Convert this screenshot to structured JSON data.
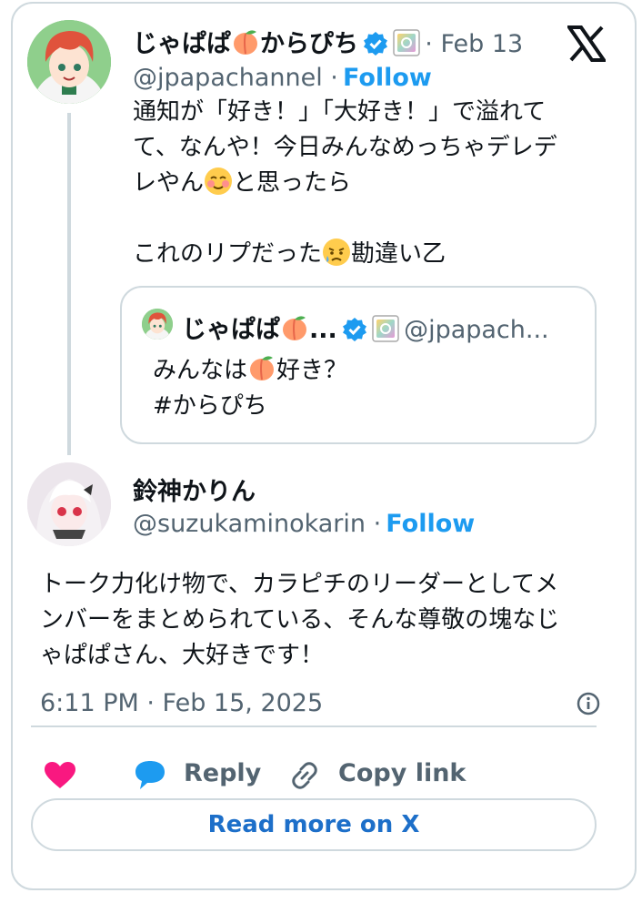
{
  "original_tweet": {
    "display_name": "じゃぱぱ🍑からぴち",
    "name_before_emoji": "じゃぱぱ",
    "name_after_emoji": "からぴち",
    "date": "· Feb 13",
    "handle": "@jpapachannel ·",
    "follow_label": "Follow",
    "text_line1": "通知が「好き！」「大好き！」で溢れて",
    "text_line2": "て、なんや！今日みんなめっちゃデレデ",
    "text_line3a": "レやん",
    "text_line3b": "と思ったら",
    "text_line4a": "これのリプだった",
    "text_line4b": "勘違い乙"
  },
  "quoted_tweet": {
    "name": "じゃぱぱ",
    "ellipsis": "...",
    "handle": "@jpapach...",
    "text_line1a": "みんなは",
    "text_line1b": "好き？",
    "text_line2": "#からぴち"
  },
  "reply_tweet": {
    "display_name": "鈴神かりん",
    "handle": "@suzukaminokarin ·",
    "follow_label": "Follow",
    "text_line1": "トーク力化け物で、カラピチのリーダーとしてメ",
    "text_line2": "ンバーをまとめられている、そんな尊敬の塊なじ",
    "text_line3": "ゃぱぱさん、大好きです！",
    "timestamp": "6:11 PM · Feb 15, 2025"
  },
  "actions": {
    "reply_label": "Reply",
    "copy_link_label": "Copy link",
    "read_more_label": "Read more on X"
  },
  "icons": {
    "like": "heart-icon",
    "reply": "speech-bubble-icon",
    "copy": "link-icon",
    "info": "info-icon",
    "logo": "x-logo-icon"
  },
  "colors": {
    "link_blue": "#1d9bf0",
    "read_more_blue": "#1d6fc9",
    "heart_pink": "#f91880",
    "border": "#cfd9de",
    "secondary_text": "#536471"
  }
}
